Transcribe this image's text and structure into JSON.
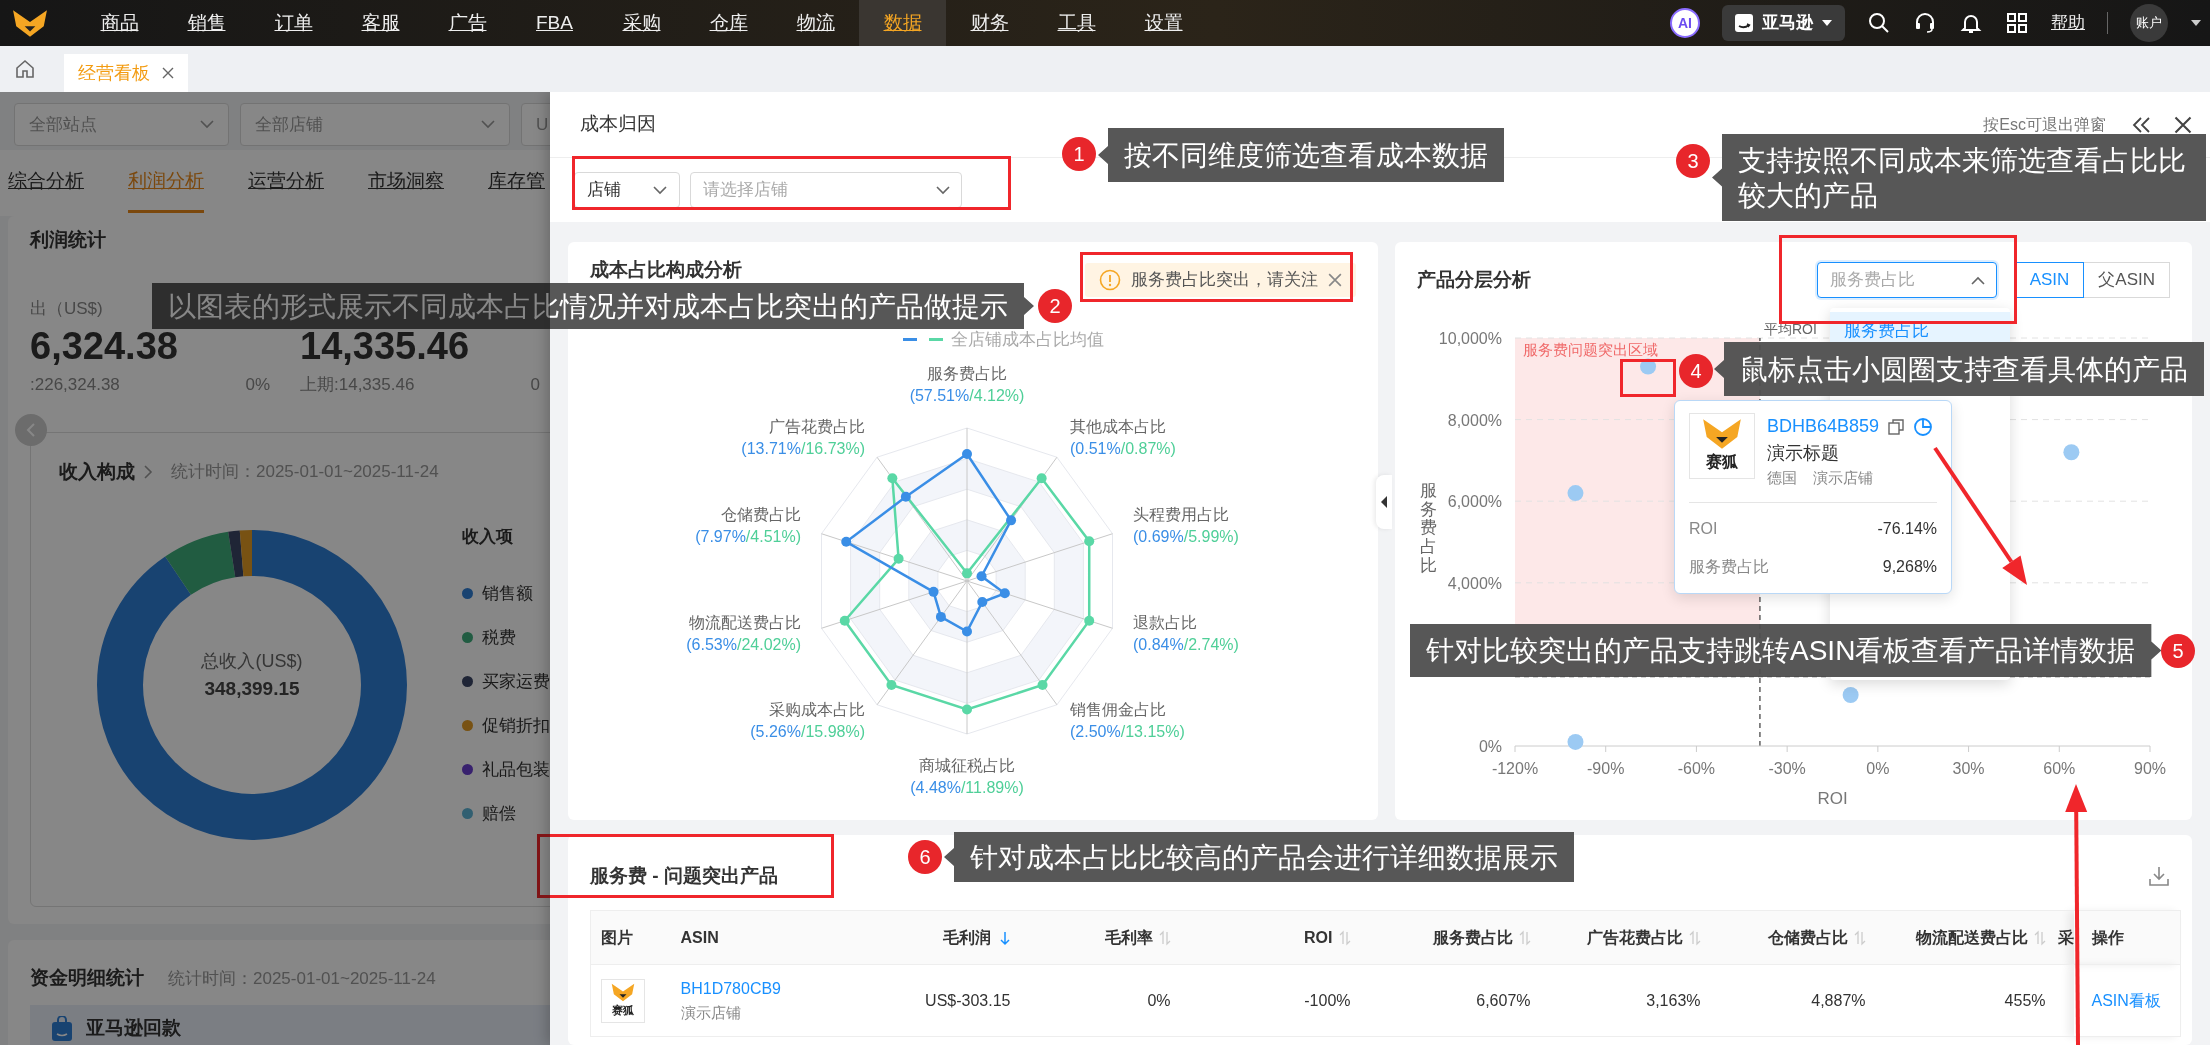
{
  "top_nav": {
    "items": [
      {
        "label": "商品",
        "selected": false
      },
      {
        "label": "销售",
        "selected": false
      },
      {
        "label": "订单",
        "selected": false
      },
      {
        "label": "客服",
        "selected": false
      },
      {
        "label": "广告",
        "selected": false
      },
      {
        "label": "FBA",
        "selected": false
      },
      {
        "label": "采购",
        "selected": false
      },
      {
        "label": "仓库",
        "selected": false
      },
      {
        "label": "物流",
        "selected": false
      },
      {
        "label": "数据",
        "selected": true
      },
      {
        "label": "财务",
        "selected": false
      },
      {
        "label": "工具",
        "selected": false
      },
      {
        "label": "设置",
        "selected": false
      }
    ],
    "ai_badge": "AI",
    "platform": "亚马逊",
    "help": "帮助",
    "account": "账户"
  },
  "page_tabs": [
    {
      "label": "经营看板",
      "selected": true
    }
  ],
  "background_page": {
    "filters": [
      "全部站点",
      "全部店铺",
      "U"
    ],
    "tabs": [
      {
        "label": "综合分析",
        "selected": false
      },
      {
        "label": "利润分析",
        "selected": true
      },
      {
        "label": "运营分析",
        "selected": false
      },
      {
        "label": "市场洞察",
        "selected": false
      },
      {
        "label": "库存管",
        "selected": false
      }
    ],
    "profit_card": {
      "title": "利润统计",
      "stats": [
        {
          "label": "出（US$)",
          "value": "6,324.38",
          "previous": ":226,324.38",
          "change": "0%"
        },
        {
          "value": "14,335.46",
          "previous": "上期:14,335.46",
          "change": "0"
        }
      ]
    },
    "income_card": {
      "title": "收入构成",
      "period": "统计时间：2025-01-01~2025-11-24",
      "center_label": "总收入(US$)",
      "center_value": "348,399.15",
      "legend_title": "收入项",
      "legend": [
        {
          "label": "销售额",
          "color": "#194371"
        },
        {
          "label": "税费",
          "color": "#215c42"
        },
        {
          "label": "买家运费",
          "color": "#1f2536"
        },
        {
          "label": "促销折扣",
          "color": "#785213"
        },
        {
          "label": "礼品包装",
          "color": "#38216e"
        },
        {
          "label": "赔偿",
          "color": "#315f71"
        }
      ]
    },
    "fund_card": {
      "title": "资金明细统计",
      "period": "统计时间：2025-01-01~2025-11-24",
      "section": "亚马逊回款"
    }
  },
  "modal": {
    "title": "成本归因",
    "esc_hint": "按Esc可退出弹窗",
    "dimension": "店铺",
    "store_select": {
      "placeholder": "请选择店铺"
    },
    "radar_card": {
      "title": "成本占比构成分析",
      "alert": "服务费占比突出，请关注",
      "legend": [
        {
          "color": "#3a8ee6"
        },
        {
          "label": "全店铺成本占比均值",
          "color": "#5ad8a6"
        }
      ],
      "axes": [
        {
          "label": "服务费占比",
          "store": "(57.51%",
          "average": "/4.12%)"
        },
        {
          "label": "广告花费占比",
          "store": "(13.71%",
          "average": "/16.73%)"
        },
        {
          "label": "其他成本占比",
          "store": "(0.51%",
          "average": "/0.87%)"
        },
        {
          "label": "仓储费占比",
          "store": "(7.97%",
          "average": "/4.51%)"
        },
        {
          "label": "头程费用占比",
          "store": "(0.69%",
          "average": "/5.99%)"
        },
        {
          "label": "物流配送费占比",
          "store": "(6.53%",
          "average": "/24.02%)"
        },
        {
          "label": "退款占比",
          "store": "(0.84%",
          "average": "/2.74%)"
        },
        {
          "label": "采购成本占比",
          "store": "(5.26%",
          "average": "/15.98%)"
        },
        {
          "label": "销售佣金占比",
          "store": "(2.50%",
          "average": "/13.15%)"
        },
        {
          "label": "商城征税占比",
          "store": "(4.48%",
          "average": "/11.89%)"
        }
      ]
    },
    "scatter_card": {
      "title": "产品分层分析",
      "metric_select": {
        "placeholder": "服务费占比",
        "open": true
      },
      "options": [
        {
          "label": "服务费占比",
          "selected": true
        }
      ],
      "id_toggle": [
        {
          "label": "ASIN",
          "selected": true
        },
        {
          "label": "父ASIN",
          "selected": false
        }
      ],
      "chart_data": {
        "type": "scatter",
        "xlabel": "ROI",
        "ylabel": "服务费占比",
        "x": [
          -76,
          -100,
          64,
          -9,
          -100
        ],
        "series": [
          {
            "color": "#9ccaf3",
            "values": [
              9300,
              6200,
              7200,
              1250,
              100
            ]
          }
        ],
        "xlim": [
          -120,
          90
        ],
        "ylim": [
          0,
          10000
        ],
        "grid": true,
        "xticks": [
          {
            "value": -120,
            "label": "-120%"
          },
          {
            "value": -90,
            "label": "-90%"
          },
          {
            "value": -60,
            "label": "-60%"
          },
          {
            "value": -30,
            "label": "-30%"
          },
          {
            "value": 0,
            "label": "0%"
          },
          {
            "value": 30,
            "label": "30%"
          },
          {
            "value": 60,
            "label": "60%"
          },
          {
            "value": 90,
            "label": "90%"
          }
        ],
        "yticks": [
          {
            "value": 0,
            "label": "0%"
          },
          {
            "value": 4000,
            "label": "4,000%"
          },
          {
            "value": 6000,
            "label": "6,000%"
          },
          {
            "value": 8000,
            "label": "8,000%"
          },
          {
            "value": 10000,
            "label": "10,000%"
          }
        ],
        "ref_lines": [
          {
            "axis": "x",
            "value": -39,
            "label": "平均ROI"
          },
          {
            "axis": "y",
            "value": 1700
          }
        ],
        "bands": [
          {
            "axis": "x",
            "from": -120,
            "to": -39,
            "label": "服务费问题突出区域"
          }
        ]
      },
      "popover": {
        "logo_text": "赛狐",
        "asin": "BDHB64B859",
        "title": "演示标题",
        "country": "德国",
        "store": "演示店铺",
        "metrics": [
          {
            "label": "ROI",
            "value": "-76.14%"
          },
          {
            "label": "服务费占比",
            "value": "9,268%"
          }
        ]
      }
    },
    "products_card": {
      "title": "服务费 - 问题突出产品",
      "columns": [
        {
          "label": "图片"
        },
        {
          "label": "ASIN"
        },
        {
          "label": "毛利润",
          "sort_desc": true
        },
        {
          "label": "毛利率",
          "sort_desc": false
        },
        {
          "label": "ROI",
          "sort_desc": false
        },
        {
          "label": "服务费占比",
          "sort_desc": false
        },
        {
          "label": "广告花费占比",
          "sort_desc": false
        },
        {
          "label": "仓储费占比",
          "sort_desc": false
        },
        {
          "label": "物流配送费占比",
          "sort_desc": false
        },
        {
          "label": "采"
        },
        {
          "label": "操作"
        }
      ],
      "rows": [
        {
          "cells": [
            {
              "kind": "logo",
              "text": "赛狐"
            },
            {
              "kind": "asin",
              "text": "BH1D780CB9",
              "store": "演示店铺"
            },
            "US$-303.15",
            "0%",
            "-100%",
            "6,607%",
            "3,163%",
            "4,887%",
            "455%",
            "",
            {
              "kind": "link",
              "text": "ASIN看板"
            }
          ]
        }
      ]
    }
  },
  "annotations": [
    {
      "number": "1",
      "text": "按不同维度筛选查看成本数据"
    },
    {
      "number": "2",
      "text": "以图表的形式展示不同成本占比情况并对成本占比突出的产品做提示"
    },
    {
      "number": "3",
      "text": "支持按照不同成本来筛选查看占比比较大的产品"
    },
    {
      "number": "4",
      "text": "鼠标点击小圆圈支持查看具体的产品"
    },
    {
      "number": "5",
      "text": "针对比较突出的产品支持跳转ASIN看板查看产品详情数据"
    },
    {
      "number": "6",
      "text": "针对成本占比比较高的产品会进行详细数据展示"
    }
  ]
}
